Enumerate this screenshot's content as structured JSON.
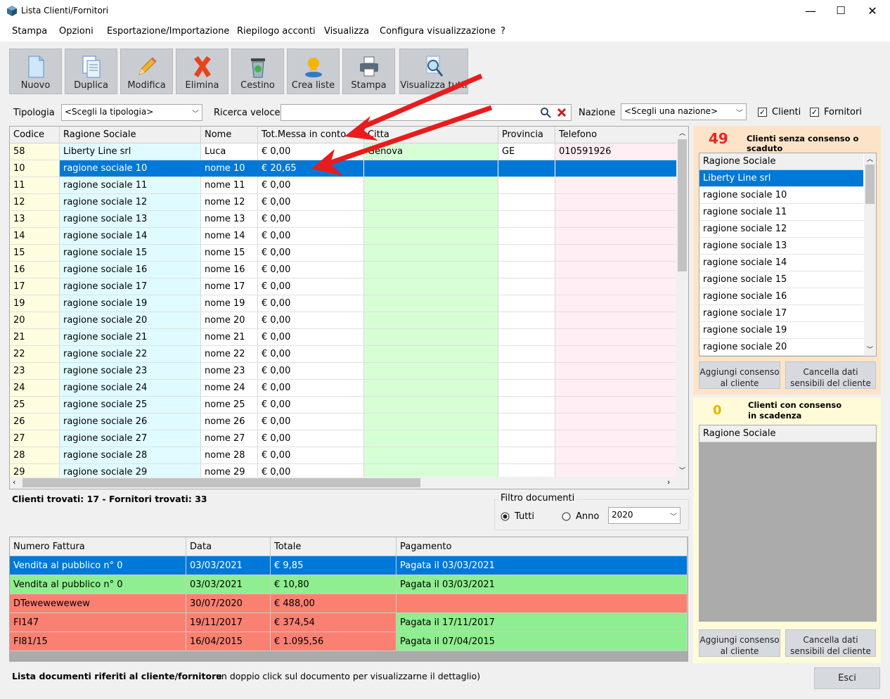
{
  "window": {
    "title": "Lista Clienti/Fornitori",
    "minimize": "—",
    "maximize": "☐",
    "close": "✕"
  },
  "menu": [
    "Stampa",
    "Opzioni",
    "Esportazione/Importazione",
    "Riepilogo acconti",
    "Visualizza",
    "Configura visualizzazione",
    "?"
  ],
  "toolbar": [
    {
      "label": "Nuovo",
      "icon": "new-document-icon"
    },
    {
      "label": "Duplica",
      "icon": "duplicate-icon"
    },
    {
      "label": "Modifica",
      "icon": "pencil-icon"
    },
    {
      "label": "Elimina",
      "icon": "delete-x-icon"
    },
    {
      "label": "Cestino",
      "icon": "trash-bin-icon"
    },
    {
      "label": "Crea liste",
      "icon": "create-lists-icon"
    },
    {
      "label": "Stampa",
      "icon": "printer-icon"
    },
    {
      "label": "Visualizza tutti",
      "icon": "magnifier-icon"
    }
  ],
  "filters": {
    "tipologia_label": "Tipologia",
    "tipologia_value": "<Scegli la tipologia>",
    "ricerca_label": "Ricerca veloce",
    "ricerca_value": "",
    "nazione_label": "Nazione",
    "nazione_value": "<Scegli una nazione>",
    "clienti_label": "Clienti",
    "clienti_checked": true,
    "fornitori_label": "Fornitori",
    "fornitori_checked": true
  },
  "grid": {
    "columns": [
      "Codice",
      "Ragione Sociale",
      "Nome",
      "Tot.Messa in conto",
      "Citta",
      "Provincia",
      "Telefono"
    ],
    "rows": [
      [
        "58",
        "Liberty Line srl",
        "Luca",
        "€ 0,00",
        "Genova",
        "GE",
        "010591926"
      ],
      [
        "10",
        "ragione sociale 10",
        "nome 10",
        "€ 20,65",
        "",
        "",
        ""
      ],
      [
        "11",
        "ragione sociale 11",
        "nome 11",
        "€ 0,00",
        "",
        "",
        ""
      ],
      [
        "12",
        "ragione sociale 12",
        "nome 12",
        "€ 0,00",
        "",
        "",
        ""
      ],
      [
        "13",
        "ragione sociale 13",
        "nome 13",
        "€ 0,00",
        "",
        "",
        ""
      ],
      [
        "14",
        "ragione sociale 14",
        "nome 14",
        "€ 0,00",
        "",
        "",
        ""
      ],
      [
        "15",
        "ragione sociale 15",
        "nome 15",
        "€ 0,00",
        "",
        "",
        ""
      ],
      [
        "16",
        "ragione sociale 16",
        "nome 16",
        "€ 0,00",
        "",
        "",
        ""
      ],
      [
        "17",
        "ragione sociale 17",
        "nome 17",
        "€ 0,00",
        "",
        "",
        ""
      ],
      [
        "19",
        "ragione sociale 19",
        "nome 19",
        "€ 0,00",
        "",
        "",
        ""
      ],
      [
        "20",
        "ragione sociale 20",
        "nome 20",
        "€ 0,00",
        "",
        "",
        ""
      ],
      [
        "21",
        "ragione sociale 21",
        "nome 21",
        "€ 0,00",
        "",
        "",
        ""
      ],
      [
        "22",
        "ragione sociale 22",
        "nome 22",
        "€ 0,00",
        "",
        "",
        ""
      ],
      [
        "23",
        "ragione sociale 23",
        "nome 23",
        "€ 0,00",
        "",
        "",
        ""
      ],
      [
        "24",
        "ragione sociale 24",
        "nome 24",
        "€ 0,00",
        "",
        "",
        ""
      ],
      [
        "25",
        "ragione sociale 25",
        "nome 25",
        "€ 0,00",
        "",
        "",
        ""
      ],
      [
        "26",
        "ragione sociale 26",
        "nome 26",
        "€ 0,00",
        "",
        "",
        ""
      ],
      [
        "27",
        "ragione sociale 27",
        "nome 27",
        "€ 0,00",
        "",
        "",
        ""
      ],
      [
        "28",
        "ragione sociale 28",
        "nome 28",
        "€ 0,00",
        "",
        "",
        ""
      ],
      [
        "29",
        "ragione sociale 29",
        "nome 29",
        "€ 0,00",
        "",
        "",
        ""
      ]
    ],
    "selected_row": 1
  },
  "summary": "Clienti trovati: 17 - Fornitori trovati: 33",
  "doc_filter": {
    "title": "Filtro documenti",
    "tutti_label": "Tutti",
    "anno_label": "Anno",
    "selected": "Tutti",
    "year": "2020"
  },
  "documents": {
    "columns": [
      "Numero Fattura",
      "Data",
      "Totale",
      "Pagamento"
    ],
    "rows": [
      {
        "cells": [
          "Vendita al pubblico n° 0",
          "03/03/2021",
          "€ 9,85",
          "Pagata il 03/03/2021"
        ],
        "status": "selected"
      },
      {
        "cells": [
          "Vendita al pubblico n° 0",
          "03/03/2021",
          "€ 10,80",
          "Pagata il 03/03/2021"
        ],
        "status": "paid"
      },
      {
        "cells": [
          "DTewewewewew",
          "30/07/2020",
          "€ 488,00",
          ""
        ],
        "status": "unpaid"
      },
      {
        "cells": [
          "FI147",
          "19/11/2017",
          "€ 374,54",
          "Pagata il 17/11/2017"
        ],
        "status": "mixed"
      },
      {
        "cells": [
          "FI81/15",
          "16/04/2015",
          "€ 1.095,56",
          "Pagata il 07/04/2015"
        ],
        "status": "mixed"
      }
    ]
  },
  "footer": {
    "bold": "Lista documenti riferiti al cliente/fornitore",
    "hint": "un doppio click sul documento per visualizzarne il dettaglio)",
    "exit": "Esci"
  },
  "panel_expired": {
    "count": "49",
    "title": "Clienti senza consenso o scaduto",
    "column": "Ragione Sociale",
    "items": [
      "Liberty Line srl",
      "ragione sociale 10",
      "ragione sociale 11",
      "ragione sociale 12",
      "ragione sociale 13",
      "ragione sociale 14",
      "ragione sociale 15",
      "ragione sociale 16",
      "ragione sociale 17",
      "ragione sociale 19",
      "ragione sociale 20"
    ],
    "add_btn": "Aggiungi consenso al cliente",
    "del_btn": "Cancella dati sensibili del cliente"
  },
  "panel_expiring": {
    "count": "0",
    "title": "Clienti con consenso in scadenza",
    "column": "Ragione Sociale",
    "items": [],
    "add_btn": "Aggiungi consenso al cliente",
    "del_btn": "Cancella dati sensibili del cliente"
  },
  "colors": {
    "selection": "#0078d7",
    "codice_bg": "#fffde0",
    "ragione_bg": "#e0fbff",
    "citta_bg": "#d6ffd6",
    "telefono_bg": "#ffeef3",
    "doc_paid": "#8fee8f",
    "doc_unpaid": "#fa8072",
    "panel1_bg": "#fde4c8",
    "panel2_bg": "#fffbd9",
    "annotation_arrow": "#e81c1c"
  }
}
